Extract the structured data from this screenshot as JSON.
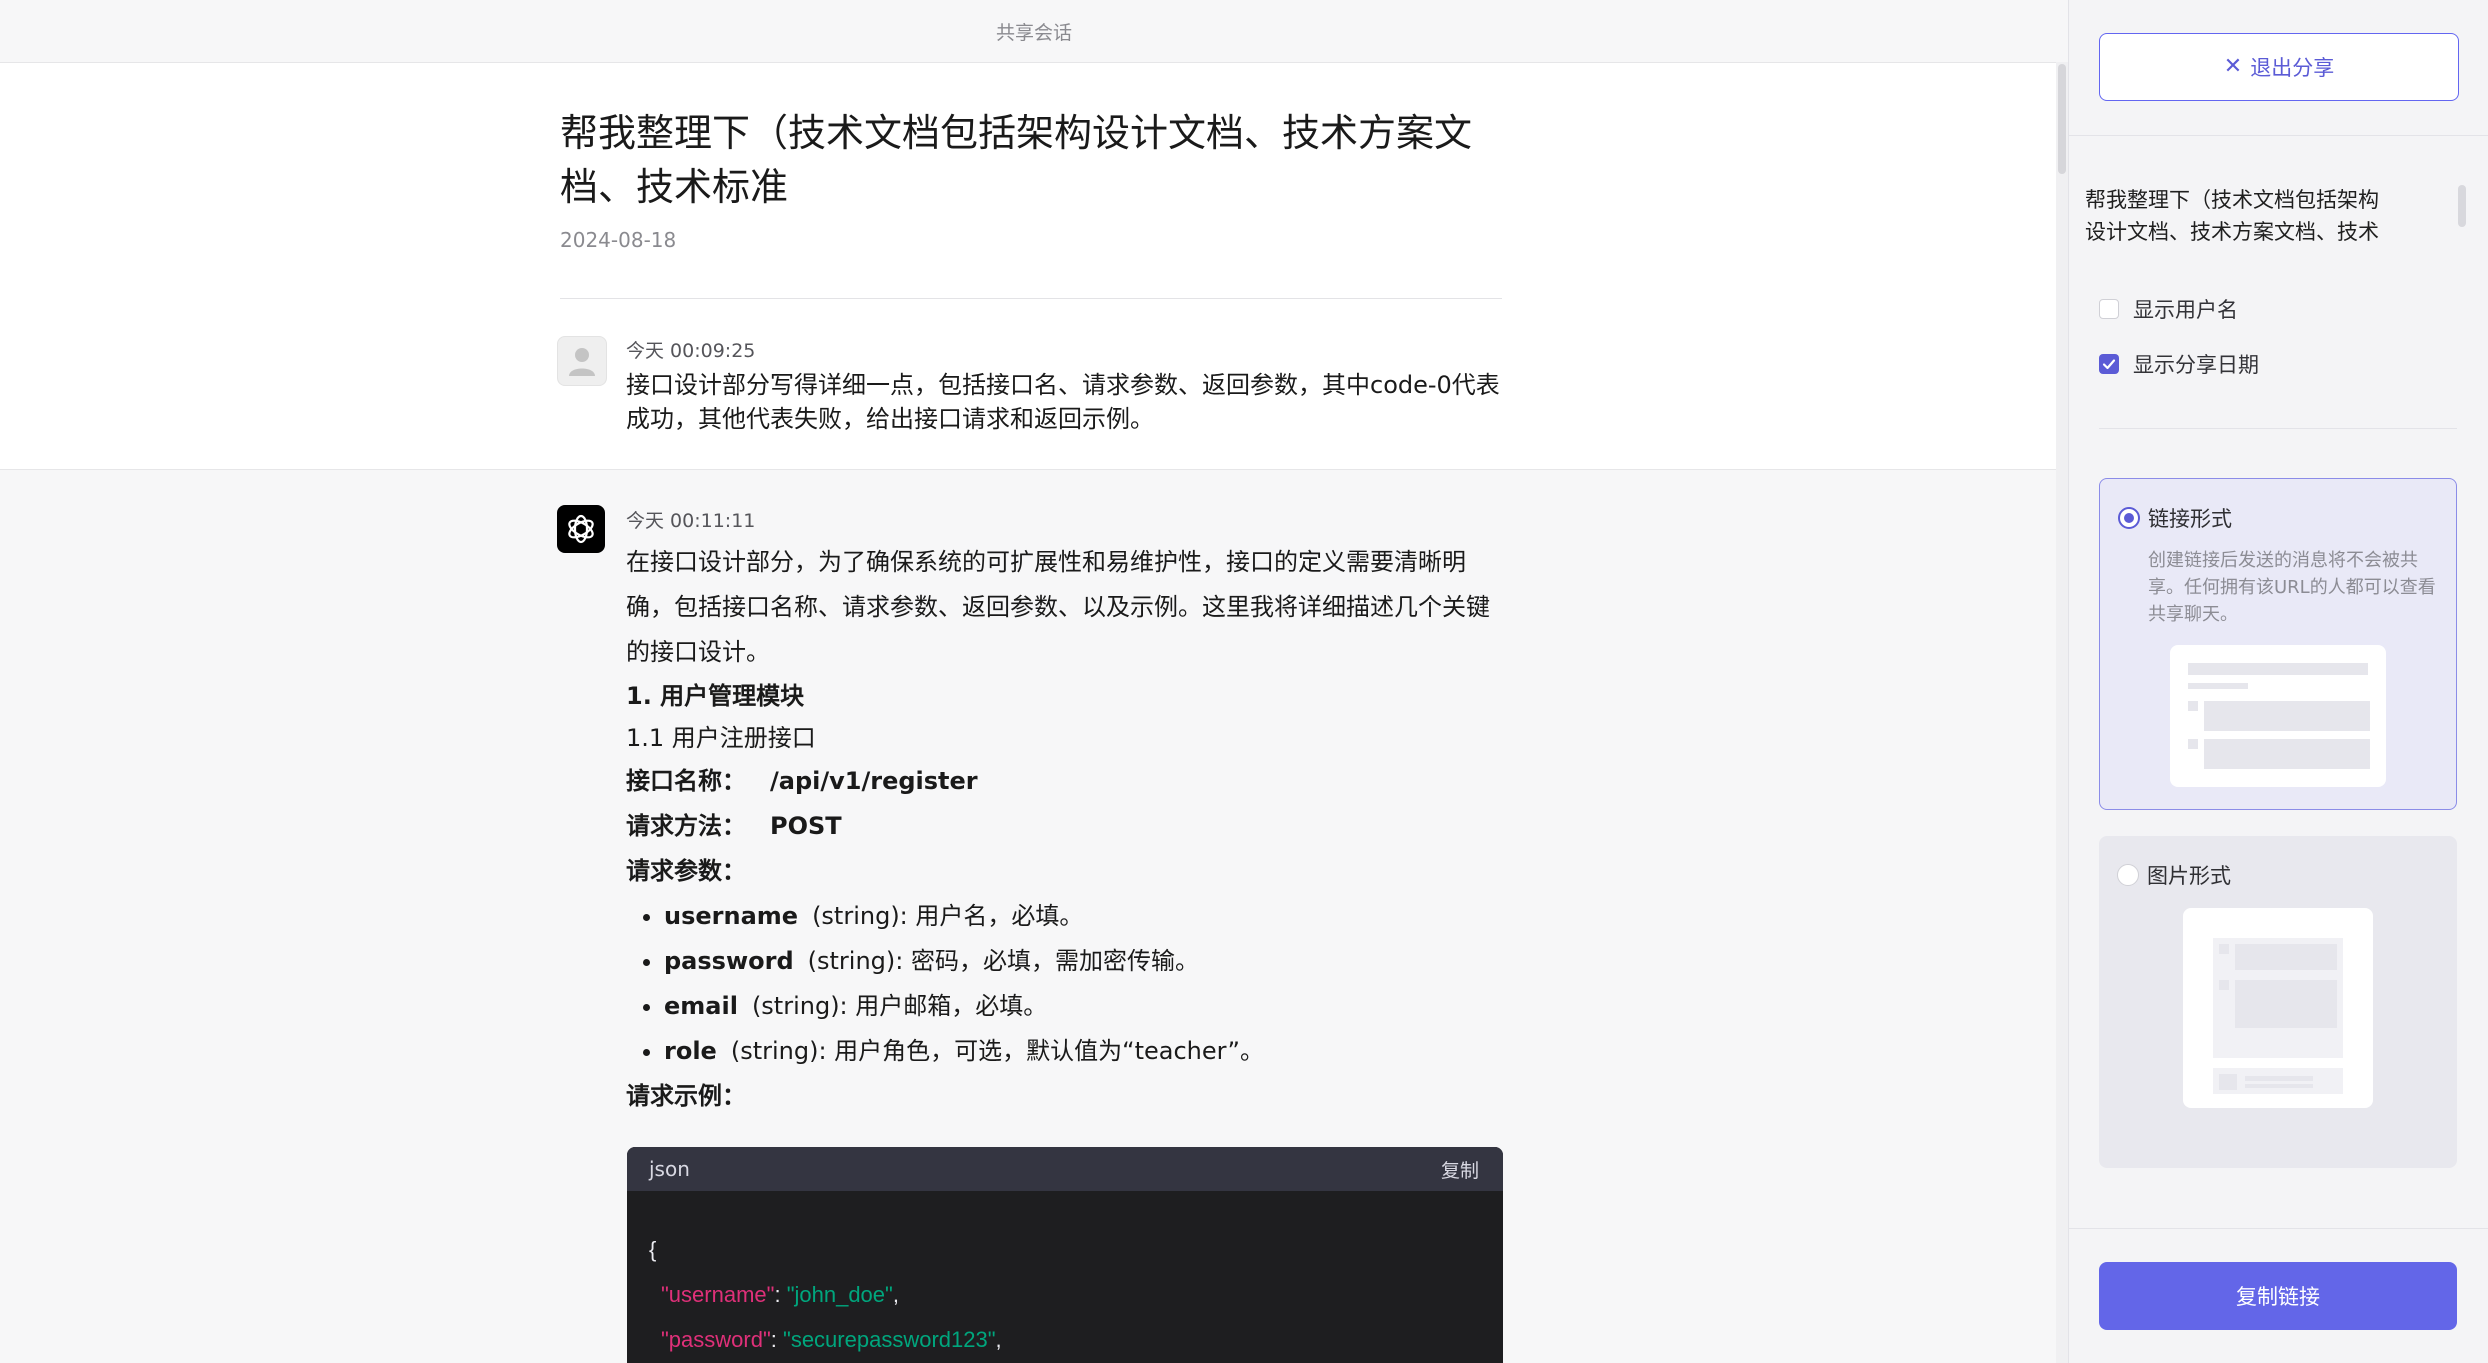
{
  "topbar": {
    "title": "共享会话"
  },
  "conversation": {
    "title": "帮我整理下（技术文档包括架构设计文档、技术方案文档、技术标准",
    "date": "2024-08-18"
  },
  "user_message": {
    "time": "今天 00:09:25",
    "text": "接口设计部分写得详细一点，包括接口名、请求参数、返回参数，其中code-0代表成功，其他代表失败，给出接口请求和返回示例。"
  },
  "ai_message": {
    "time": "今天 00:11:11",
    "intro": "在接口设计部分，为了确保系统的可扩展性和易维护性，接口的定义需要清晰明确，包括接口名称、请求参数、返回参数、以及示例。这里我将详细描述几个关键的接口设计。",
    "section_heading": "1. 用户管理模块",
    "sub_heading": "1.1 用户注册接口",
    "api_name_label": "接口名称：",
    "api_name_value": "/api/v1/register",
    "method_label": "请求方法：",
    "method_value": "POST",
    "params_label": "请求参数：",
    "params": [
      {
        "name": "username",
        "desc": "(string): 用户名，必填。"
      },
      {
        "name": "password",
        "desc": "(string): 密码，必填，需加密传输。"
      },
      {
        "name": "email",
        "desc": "(string): 用户邮箱，必填。"
      },
      {
        "name": "role",
        "desc": "(string): 用户角色，可选，默认值为“teacher”。"
      }
    ],
    "example_label": "请求示例：",
    "code": {
      "lang": "json",
      "copy_label": "复制",
      "open_brace": "{",
      "lines": [
        {
          "key": "\"username\"",
          "value": "\"john_doe\""
        },
        {
          "key": "\"password\"",
          "value": "\"securepassword123\""
        }
      ]
    }
  },
  "panel": {
    "exit_label": "退出分享",
    "preview_text": "帮我整理下（技术文档包括架构设计文档、技术方案文档、技术",
    "options": [
      {
        "label": "显示用户名",
        "checked": false
      },
      {
        "label": "显示分享日期",
        "checked": true
      }
    ],
    "link_mode": {
      "label": "链接形式",
      "description": "创建链接后发送的消息将不会被共享。任何拥有该URL的人都可以查看共享聊天。",
      "selected": true
    },
    "image_mode": {
      "label": "图片形式",
      "selected": false
    },
    "copy_button": "复制链接",
    "accent_color": "#6366e8"
  }
}
